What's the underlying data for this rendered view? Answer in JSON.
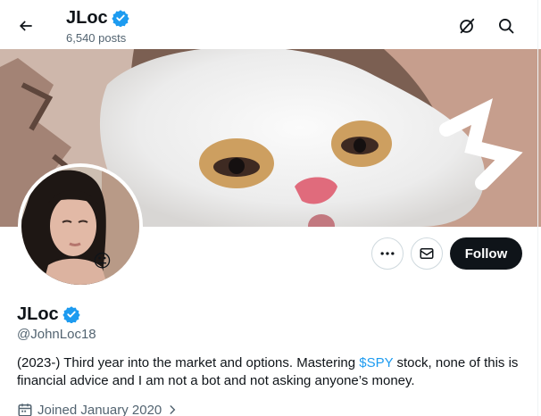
{
  "header": {
    "title": "JLoc",
    "post_count": "6,540 posts"
  },
  "profile": {
    "display_name": "JLoc",
    "handle": "@JohnLoc18",
    "bio_before": "(2023-) Third year into the market and options. Mastering ",
    "bio_cashtag": "$SPY",
    "bio_after": " stock, none of this is financial advice and I am not a bot and not asking anyone’s money.",
    "joined": "Joined January 2020",
    "avatar_emoji": "😐"
  },
  "actions": {
    "follow_label": "Follow"
  },
  "icons": {
    "back": "back-arrow-icon",
    "grok": "grok-icon",
    "search": "search-icon",
    "more": "more-icon",
    "message": "envelope-icon",
    "verified": "verified-badge-icon",
    "calendar": "calendar-icon",
    "chevron": "chevron-right-icon"
  },
  "colors": {
    "accent": "#1d9bf0",
    "text": "#0f1419",
    "secondary": "#536471",
    "follow_bg": "#0f1419"
  }
}
